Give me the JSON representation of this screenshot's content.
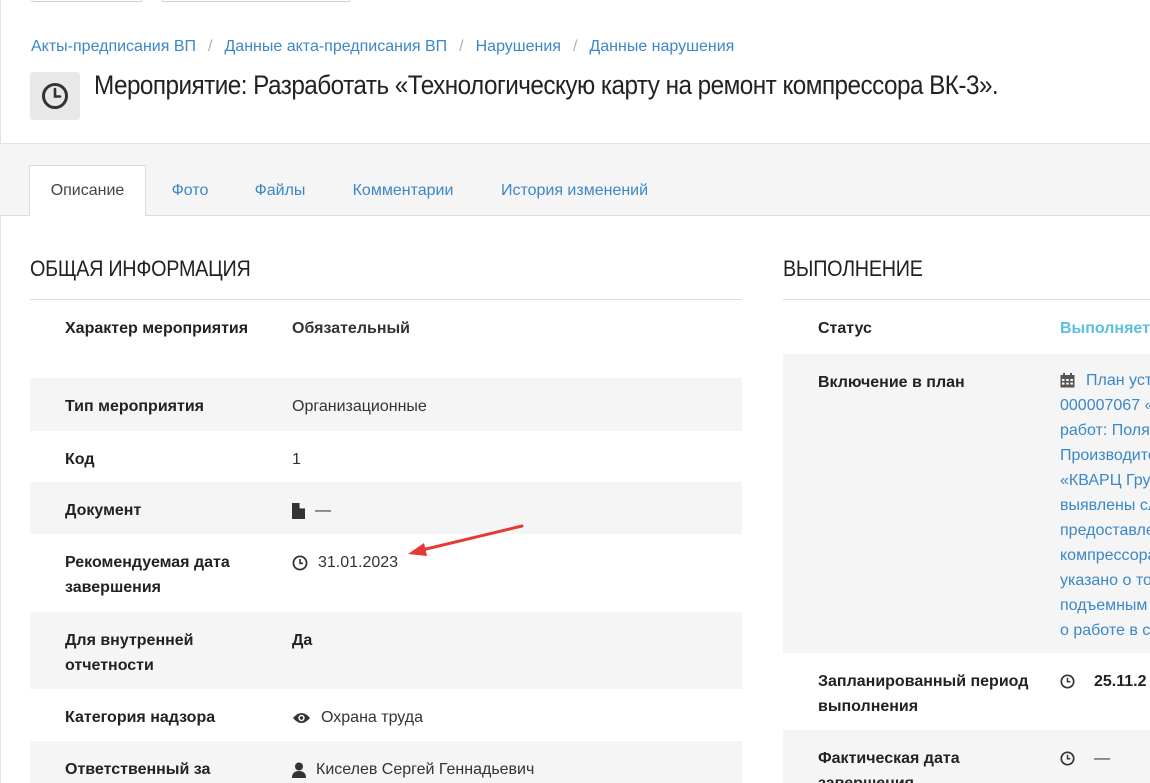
{
  "breadcrumb": [
    "Акты-предписания ВП",
    "Данные акта-предписания ВП",
    "Нарушения",
    "Данные нарушения"
  ],
  "page_title": "Мероприятие: Разработать «Технологическую карту на ремонт компрессора ВК-3».",
  "tabs": [
    "Описание",
    "Фото",
    "Файлы",
    "Комментарии",
    "История изменений"
  ],
  "general": {
    "title": "ОБЩАЯ ИНФОРМАЦИЯ",
    "rows": [
      {
        "label": "Характер мероприятия",
        "value": "Обязательный"
      },
      {
        "label": "Тип мероприятия",
        "value": "Организационные"
      },
      {
        "label": "Код",
        "value": "1"
      },
      {
        "label": "Документ",
        "value": "—"
      },
      {
        "label": "Рекомендуемая дата завершения",
        "value": "31.01.2023"
      },
      {
        "label": "Для внутренней отчетности",
        "value": "Да"
      },
      {
        "label": "Категория надзора",
        "value": "Охрана труда"
      },
      {
        "label": "Ответственный за",
        "value": "Киселев Сергей Геннадьевич"
      }
    ]
  },
  "execution": {
    "title": "ВЫПОЛНЕНИЕ",
    "status_label": "Статус",
    "status_value": "Выполняет",
    "plan_label": "Включение в план",
    "plan_lines": [
      "План уст",
      "000007067 «",
      "работ: Поля",
      "Производите",
      "«КВАРЦ Гру",
      "выявлены сл",
      "предоставле",
      "компрессора",
      "указано о то",
      "подъемным",
      "о работе в с"
    ],
    "planned_label": "Запланированный период выполнения",
    "planned_value": "25.11.2",
    "actual_label": "Фактическая дата завершения",
    "actual_value": "—"
  },
  "colors": {
    "link": "#3a87c9",
    "required": "#d9534f",
    "status": "#5bc0de",
    "arrow": "#e53935"
  }
}
